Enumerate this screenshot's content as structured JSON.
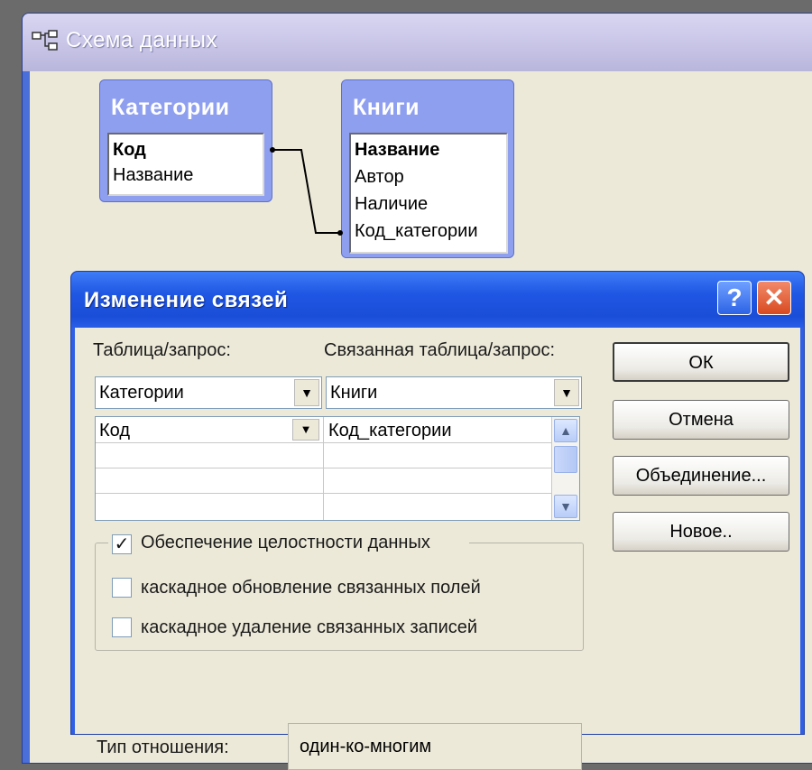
{
  "main_window": {
    "title": "Схема данных"
  },
  "tables": [
    {
      "name": "Категории",
      "fields": [
        {
          "name": "Код",
          "key": true
        },
        {
          "name": "Название",
          "key": false
        }
      ]
    },
    {
      "name": "Книги",
      "fields": [
        {
          "name": "Название",
          "key": true
        },
        {
          "name": "Автор",
          "key": false
        },
        {
          "name": "Наличие",
          "key": false
        },
        {
          "name": "Код_категории",
          "key": false
        }
      ]
    }
  ],
  "dialog": {
    "title": "Изменение связей",
    "help_glyph": "?",
    "close_glyph": "✕",
    "table_label": "Таблица/запрос:",
    "related_label": "Связанная таблица/запрос:",
    "table_value": "Категории",
    "related_value": "Книги",
    "grid_rows": [
      {
        "left": "Код",
        "right": "Код_категории"
      },
      {
        "left": "",
        "right": ""
      },
      {
        "left": "",
        "right": ""
      },
      {
        "left": "",
        "right": ""
      }
    ],
    "options": [
      {
        "label": "Обеспечение целостности данных",
        "checked": true
      },
      {
        "label": "каскадное обновление связанных полей",
        "checked": false
      },
      {
        "label": "каскадное удаление связанных записей",
        "checked": false
      }
    ],
    "buttons": {
      "ok": "ОК",
      "cancel": "Отмена",
      "join": "Объединение...",
      "new": "Новое.."
    },
    "relation_type_label": "Тип отношения:",
    "relation_type_value": "один-ко-многим"
  },
  "colors": {
    "titlebar_blue": "#1f56e3",
    "dialog_face": "#ece9d8",
    "table_header": "#8f9ff0"
  }
}
